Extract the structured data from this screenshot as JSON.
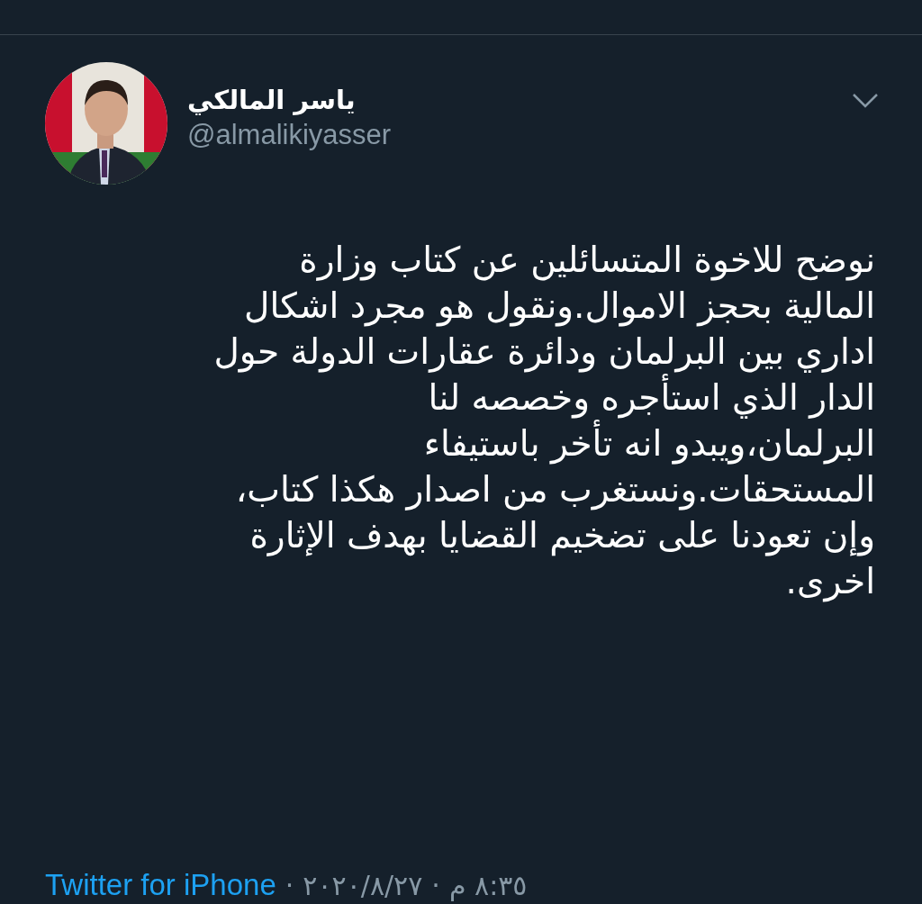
{
  "tweet": {
    "author": {
      "name": "ياسر المالكي",
      "handle": "@almalikiyasser"
    },
    "text_lines": [
      "نوضح للاخوة المتسائلين عن كتاب وزارة",
      "المالية بحجز الاموال.ونقول هو مجرد اشكال",
      "اداري بين البرلمان ودائرة عقارات الدولة حول",
      "الدار الذي استأجره وخصصه لنا",
      "البرلمان،ويبدو انه تأخر باستيفاء",
      "المستحقات.ونستغرب من اصدار هكذا كتاب،",
      "وإن تعودنا على تضخيم القضايا بهدف الإثارة",
      "اخرى."
    ],
    "source": "Twitter for iPhone",
    "separator": "·",
    "date": "٢٠٢٠/٨/٢٧",
    "time": "٨:٣٥ م"
  }
}
